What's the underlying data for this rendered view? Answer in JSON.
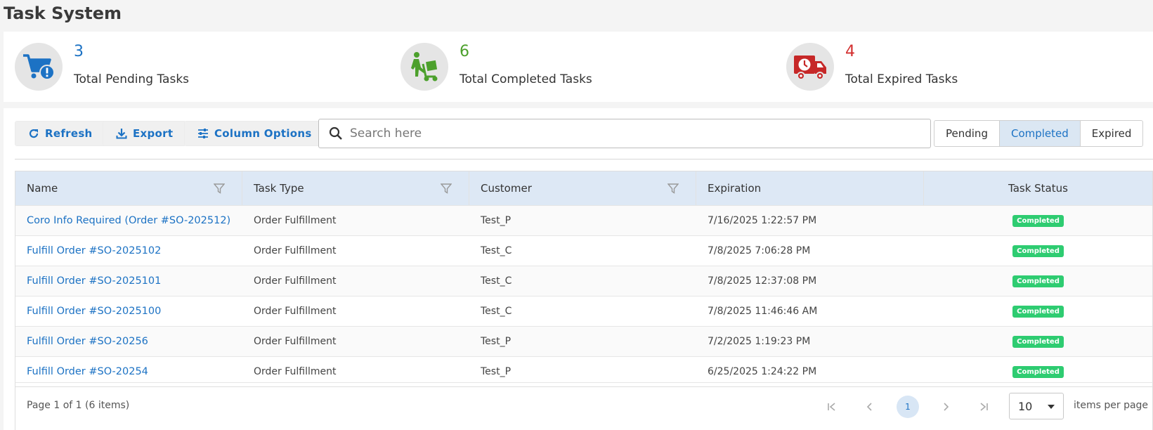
{
  "page": {
    "title": "Task System"
  },
  "stats": [
    {
      "count": "3",
      "label": "Total Pending Tasks",
      "color": "#1c72c4",
      "icon": "cart-alert-icon"
    },
    {
      "count": "6",
      "label": "Total Completed Tasks",
      "color": "#4ca02c",
      "icon": "hand-truck-icon"
    },
    {
      "count": "4",
      "label": "Total Expired Tasks",
      "color": "#d32f2f",
      "icon": "delivery-truck-clock-icon"
    }
  ],
  "toolbar": {
    "refresh_label": "Refresh",
    "export_label": "Export",
    "column_options_label": "Column Options",
    "search_placeholder": "Search here",
    "filters": [
      "Pending",
      "Completed",
      "Expired"
    ],
    "active_filter": "Completed"
  },
  "table": {
    "columns": [
      "Name",
      "Task Type",
      "Customer",
      "Expiration",
      "Task Status"
    ],
    "rows": [
      {
        "name": "Coro Info Required (Order #SO-202512)",
        "type": "Order Fulfillment",
        "customer": "Test_P",
        "expiration": "7/16/2025 1:22:57 PM",
        "status": "Completed"
      },
      {
        "name": "Fulfill Order #SO-2025102",
        "type": "Order Fulfillment",
        "customer": "Test_C",
        "expiration": "7/8/2025 7:06:28 PM",
        "status": "Completed"
      },
      {
        "name": "Fulfill Order #SO-2025101",
        "type": "Order Fulfillment",
        "customer": "Test_C",
        "expiration": "7/8/2025 12:37:08 PM",
        "status": "Completed"
      },
      {
        "name": "Fulfill Order #SO-2025100",
        "type": "Order Fulfillment",
        "customer": "Test_C",
        "expiration": "7/8/2025 11:46:46 AM",
        "status": "Completed"
      },
      {
        "name": "Fulfill Order #SO-20256",
        "type": "Order Fulfillment",
        "customer": "Test_P",
        "expiration": "7/2/2025 1:19:23 PM",
        "status": "Completed"
      },
      {
        "name": "Fulfill Order #SO-20254",
        "type": "Order Fulfillment",
        "customer": "Test_P",
        "expiration": "6/25/2025 1:24:22 PM",
        "status": "Completed"
      }
    ]
  },
  "pager": {
    "info": "Page 1 of 1 (6 items)",
    "current_page": "1",
    "page_size": "10",
    "page_size_label": "items per page"
  },
  "colors": {
    "accent": "#1c72c4",
    "header_bg": "#dde8f5",
    "badge_green": "#2ecc71"
  }
}
